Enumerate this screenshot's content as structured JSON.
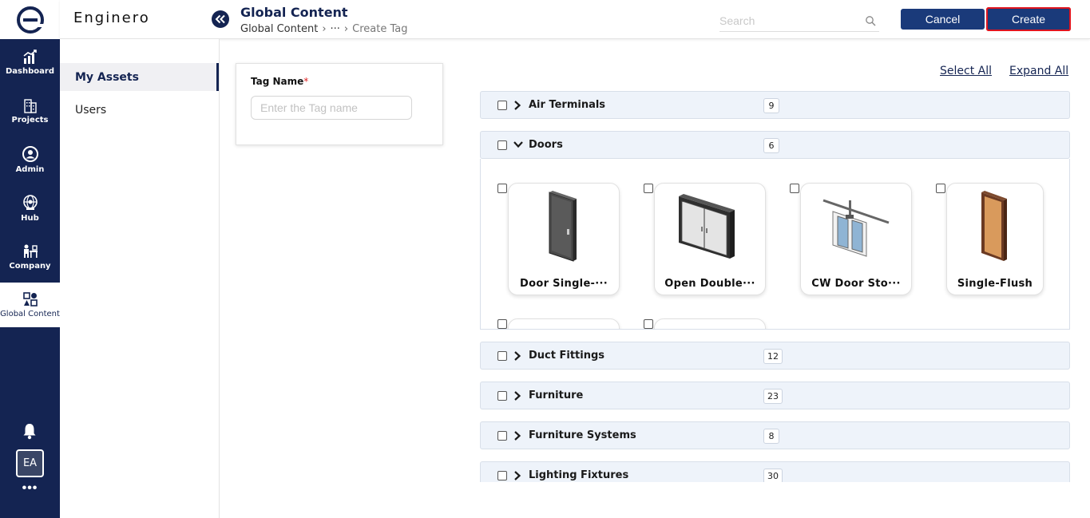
{
  "app": {
    "brand": "Enginero",
    "logo_letter": "e"
  },
  "rail": {
    "items": [
      {
        "label": "Dashboard",
        "icon": "dashboard-chart-icon"
      },
      {
        "label": "Projects",
        "icon": "building-icon"
      },
      {
        "label": "Admin",
        "icon": "user-circle-icon"
      },
      {
        "label": "Hub",
        "icon": "globe-user-icon"
      },
      {
        "label": "Company",
        "icon": "company-desk-icon"
      },
      {
        "label": "Global Content",
        "icon": "grid-shapes-icon"
      }
    ],
    "avatar": "EA",
    "more": "•••"
  },
  "header": {
    "title": "Global Content",
    "breadcrumb": {
      "root": "Global Content",
      "sep1": "›",
      "ellipsis": "···",
      "sep2": "›",
      "current": "Create Tag"
    },
    "search": {
      "placeholder": "Search",
      "value": ""
    },
    "cancel_label": "Cancel",
    "create_label": "Create"
  },
  "subnav": {
    "items": [
      {
        "label": "My Assets",
        "active": true
      },
      {
        "label": "Users",
        "active": false
      }
    ]
  },
  "tag_form": {
    "label": "Tag Name",
    "required_mark": "*",
    "placeholder": "Enter the Tag name",
    "value": ""
  },
  "actions": {
    "select_all": "Select All",
    "expand_all": "Expand All"
  },
  "categories": [
    {
      "name": "Air Terminals",
      "count": "9",
      "expanded": false
    },
    {
      "name": "Doors",
      "count": "6",
      "expanded": true
    },
    {
      "name": "Duct Fittings",
      "count": "12",
      "expanded": false
    },
    {
      "name": "Furniture",
      "count": "23",
      "expanded": false
    },
    {
      "name": "Furniture Systems",
      "count": "8",
      "expanded": false
    },
    {
      "name": "Lighting Fixtures",
      "count": "30",
      "expanded": false
    }
  ],
  "door_assets": [
    {
      "name": "Door Single-···",
      "thumb": "single-door-icon"
    },
    {
      "name": "Open Double···",
      "thumb": "double-door-icon"
    },
    {
      "name": "CW Door Sto···",
      "thumb": "curtain-wall-door-icon"
    },
    {
      "name": "Single-Flush",
      "thumb": "flush-door-icon"
    }
  ]
}
